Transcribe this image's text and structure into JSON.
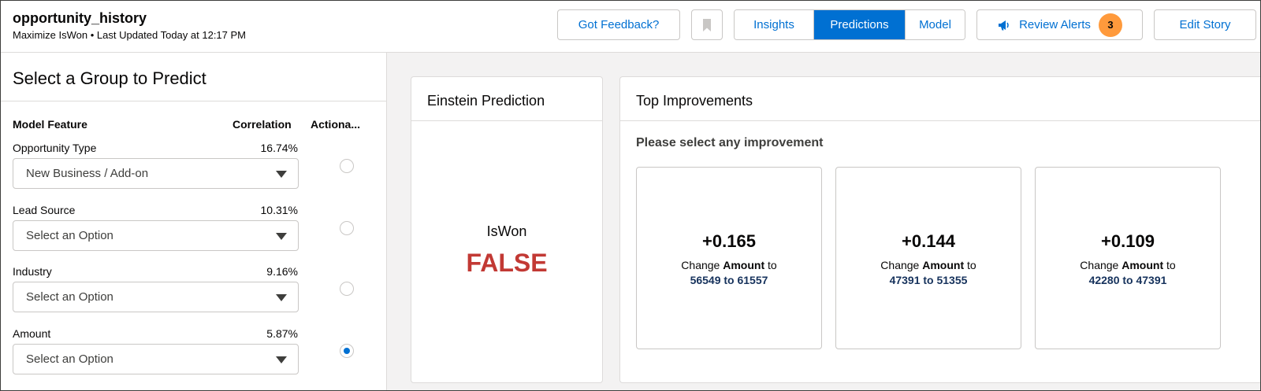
{
  "header": {
    "title": "opportunity_history",
    "subtitle": "Maximize IsWon • Last Updated Today at 12:17 PM",
    "feedback_label": "Got Feedback?",
    "tabs": [
      {
        "label": "Insights",
        "active": false
      },
      {
        "label": "Predictions",
        "active": true
      },
      {
        "label": "Model",
        "active": false
      }
    ],
    "review_alerts_label": "Review Alerts",
    "review_alerts_count": "3",
    "edit_story_label": "Edit Story"
  },
  "left_panel": {
    "title": "Select a Group to Predict",
    "columns": {
      "feature": "Model Feature",
      "correlation": "Correlation",
      "actionable": "Actiona..."
    },
    "features": [
      {
        "label": "Opportunity Type",
        "correlation": "16.74%",
        "value": "New Business / Add-on",
        "actionable": false
      },
      {
        "label": "Lead Source",
        "correlation": "10.31%",
        "value": "Select an Option",
        "actionable": false
      },
      {
        "label": "Industry",
        "correlation": "9.16%",
        "value": "Select an Option",
        "actionable": false
      },
      {
        "label": "Amount",
        "correlation": "5.87%",
        "value": "Select an Option",
        "actionable": true
      }
    ]
  },
  "prediction": {
    "title": "Einstein Prediction",
    "label": "IsWon",
    "value": "FALSE",
    "value_color": "#c23934"
  },
  "improvements": {
    "title": "Top Improvements",
    "prompt": "Please select any improvement",
    "items": [
      {
        "delta": "+0.165",
        "prefix": "Change ",
        "field": "Amount",
        "suffix": " to",
        "range": "56549 to 61557"
      },
      {
        "delta": "+0.144",
        "prefix": "Change ",
        "field": "Amount",
        "suffix": " to",
        "range": "47391 to 51355"
      },
      {
        "delta": "+0.109",
        "prefix": "Change ",
        "field": "Amount",
        "suffix": " to",
        "range": "42280 to 47391"
      }
    ]
  },
  "colors": {
    "brand": "#0070d2",
    "badge": "#ff9a3c",
    "false_red": "#c23934",
    "range_blue": "#16325c"
  },
  "icons": {
    "bookmark": "bookmark-icon",
    "alerts": "megaphone-icon",
    "dropdown": "chevron-down-icon"
  }
}
